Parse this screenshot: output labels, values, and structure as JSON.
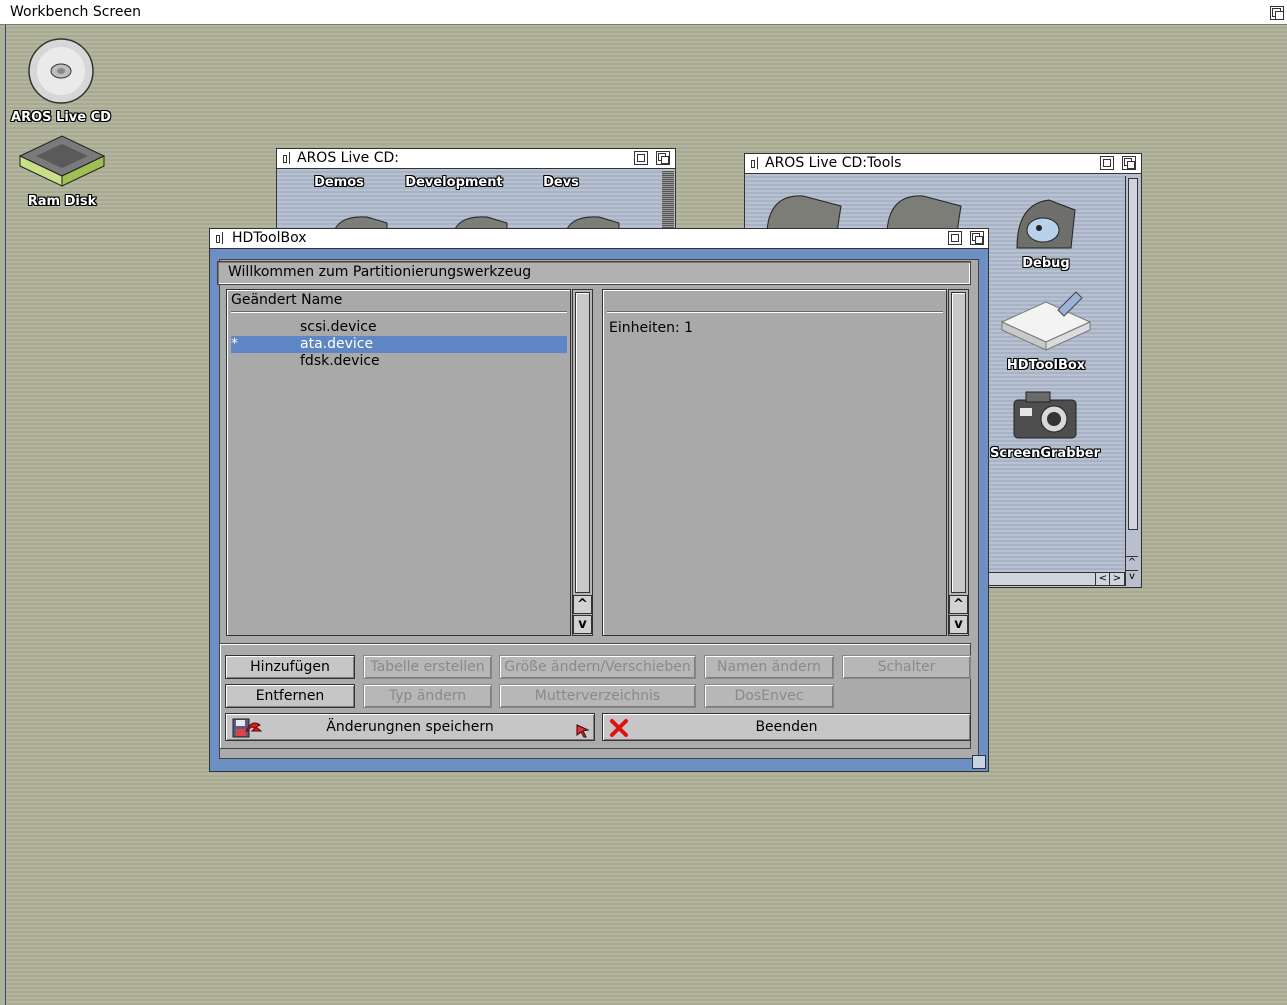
{
  "screen": {
    "title": "Workbench Screen"
  },
  "desktop_icons": [
    {
      "label": "AROS Live CD",
      "icon": "cd-disc-icon"
    },
    {
      "label": "Ram Disk",
      "icon": "ram-disk-icon"
    }
  ],
  "live_cd_window": {
    "title": "AROS Live CD:",
    "items": [
      "Demos",
      "Development",
      "Devs"
    ]
  },
  "tools_window": {
    "title": "AROS Live CD:Tools",
    "items": [
      "Debug",
      "HDToolBox",
      "ScreenGrabber"
    ]
  },
  "hdtoolbox": {
    "title": "HDToolBox",
    "welcome": "Willkommen zum Partitionierungswerkzeug",
    "list_header": "Geändert Name",
    "devices": [
      {
        "changed": "",
        "name": "scsi.device",
        "selected": false
      },
      {
        "changed": "*",
        "name": "ata.device",
        "selected": true
      },
      {
        "changed": "",
        "name": "fdsk.device",
        "selected": false
      }
    ],
    "info": "Einheiten: 1",
    "buttons": {
      "add": "Hinzufügen",
      "create_table": "Tabelle erstellen",
      "resize_move": "Größe ändern/Verschieben",
      "rename": "Namen ändern",
      "switches": "Schalter",
      "remove": "Entfernen",
      "change_type": "Typ ändern",
      "parent": "Mutterverzeichnis",
      "dosenvec": "DosEnvec",
      "save": "Änderungnen speichern",
      "quit": "Beenden"
    },
    "scroll_up": "^",
    "scroll_down": "v"
  },
  "colors": {
    "desktop": "#b0b19a",
    "selection": "#5f86c4",
    "window_frame": "#6d8fc3"
  }
}
